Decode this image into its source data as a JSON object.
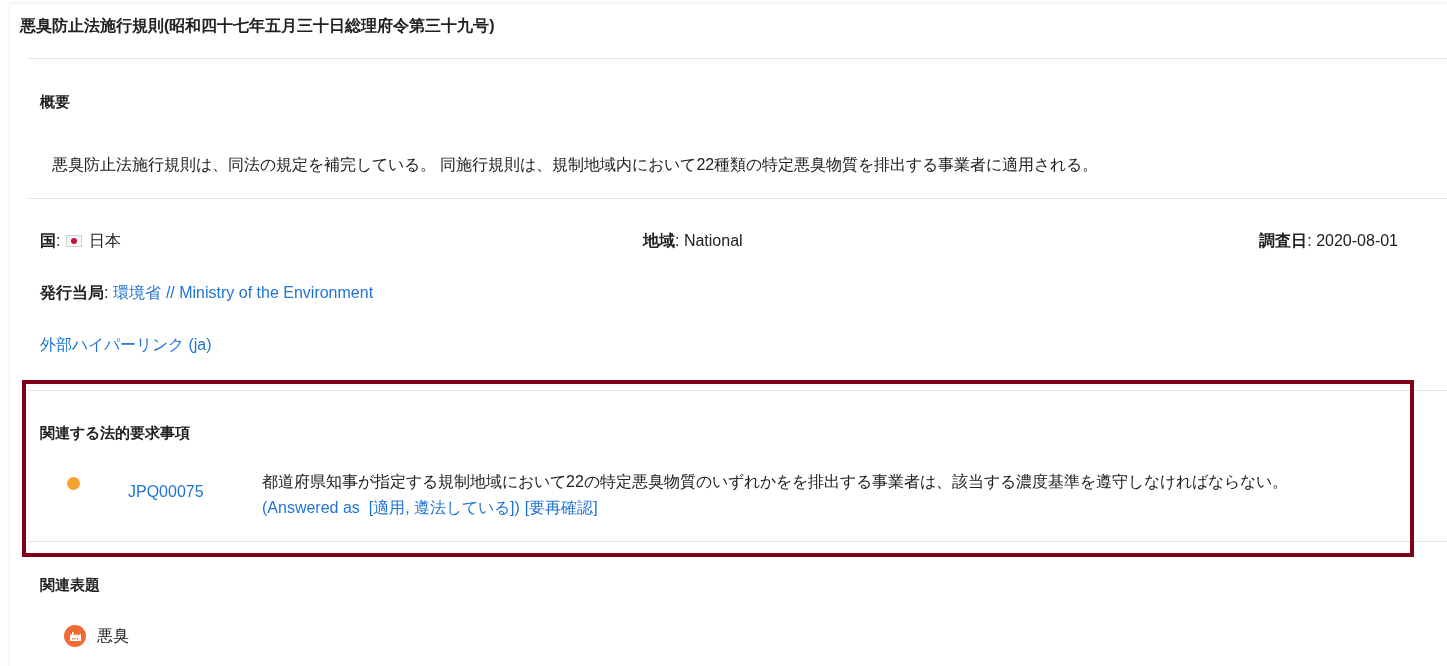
{
  "title": "悪臭防止法施行規則(昭和四十七年五月三十日総理府令第三十九号)",
  "overview": {
    "heading": "概要",
    "text": "悪臭防止法施行規則は、同法の規定を補完している。 同施行規則は、規制地域内において22種類の特定悪臭物質を排出する事業者に適用される。"
  },
  "details": {
    "country": {
      "label": "**国**:",
      "value": "日本"
    },
    "region": "**地域**: National",
    "survey_date": "**調査日**: 2020-08-01",
    "authority": {
      "label": "**発行当局**:",
      "link": "環境省 // Ministry of the Environment"
    },
    "external_link": "外部ハイパーリンク (ja)"
  },
  "related_requirements": {
    "heading": "関連する法的要求事項",
    "highlighted": true,
    "items": [
      {
        "color": "#f7a22e",
        "code": "JPQ00075",
        "text": "都道府県知事が指定する規制地域において22の特定悪臭物質のいずれかをを排出する事業者は、該当する濃度基準を遵守しなければならない。",
        "answer": "(Answered as  [適用, 遵法している])",
        "recheck": "[要再確認]"
      }
    ]
  },
  "related_topics": {
    "heading": "関連表題",
    "items": [
      {
        "label": "悪臭"
      }
    ]
  }
}
